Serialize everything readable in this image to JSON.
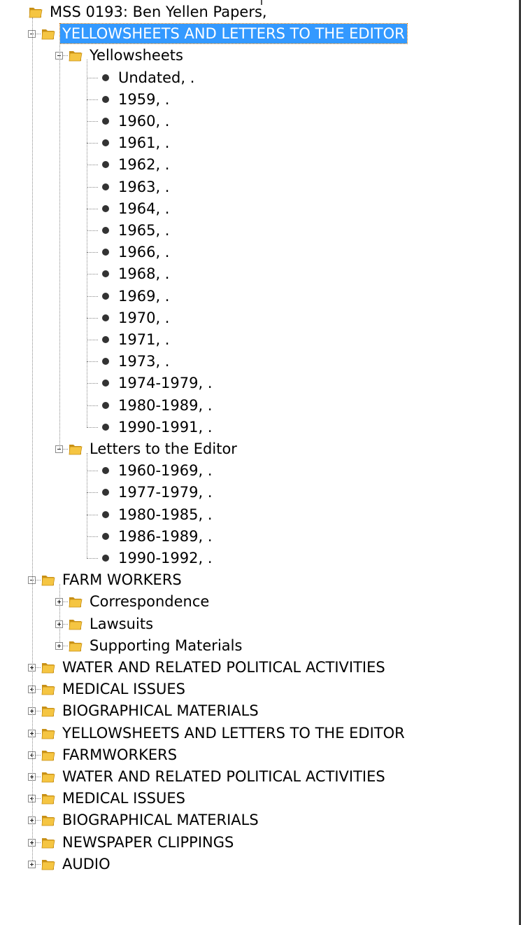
{
  "colors": {
    "selection": "#3399ff",
    "folder_fill": "#f5c542",
    "folder_stroke": "#c89016",
    "tree_line": "#8a8a8a"
  },
  "tree": {
    "root": {
      "label": "MSS 0193: Ben Yellen Papers,",
      "icon": "folder-icon"
    },
    "series1": {
      "label": "YELLOWSHEETS AND LETTERS TO THE EDITOR",
      "expanded": true,
      "selected": true,
      "children": [
        {
          "label": "Yellowsheets",
          "expanded": true,
          "items": [
            "Undated, .",
            "1959, .",
            "1960, .",
            "1961, .",
            "1962, .",
            "1963, .",
            "1964, .",
            "1965, .",
            "1966, .",
            "1968, .",
            "1969, .",
            "1970, .",
            "1971, .",
            "1973, .",
            "1974-1979, .",
            "1980-1989, .",
            "1990-1991, ."
          ]
        },
        {
          "label": "Letters to the Editor",
          "expanded": true,
          "items": [
            "1960-1969, .",
            "1977-1979, .",
            "1980-1985, .",
            "1986-1989, .",
            "1990-1992, ."
          ]
        }
      ]
    },
    "series2": {
      "label": "FARM WORKERS",
      "expanded": true,
      "children": [
        "Correspondence",
        "Lawsuits",
        "Supporting Materials"
      ]
    },
    "collapsed_series": [
      "WATER AND RELATED POLITICAL ACTIVITIES",
      "MEDICAL ISSUES",
      "BIOGRAPHICAL MATERIALS",
      "YELLOWSHEETS AND LETTERS TO THE EDITOR",
      "FARMWORKERS",
      "WATER AND RELATED POLITICAL ACTIVITIES",
      "MEDICAL ISSUES",
      "BIOGRAPHICAL MATERIALS",
      "NEWSPAPER CLIPPINGS",
      "AUDIO"
    ]
  }
}
